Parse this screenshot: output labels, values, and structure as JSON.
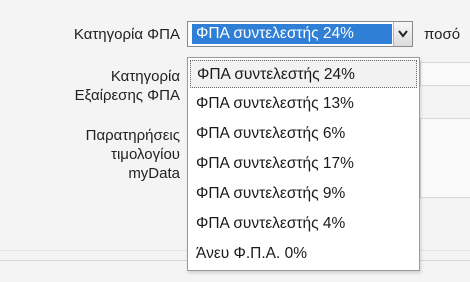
{
  "form": {
    "vat_category_label": "Κατηγορία ΦΠΑ",
    "exempt_label_line1": "Κατηγορία",
    "exempt_label_line2": "Εξαίρεσης ΦΠΑ",
    "notes_label_line1": "Παρατηρήσεις",
    "notes_label_line2": "τιμολογίου",
    "notes_label_line3": "myData",
    "next_field_label_partial": "ποσό"
  },
  "vat_select": {
    "selected": "ΦΠΑ συντελεστής 24%",
    "arrow_icon": "chevron-down-icon",
    "options": [
      "ΦΠΑ συντελεστής 24%",
      "ΦΠΑ συντελεστής 13%",
      "ΦΠΑ συντελεστής 6%",
      "ΦΠΑ συντελεστής 17%",
      "ΦΠΑ συντελεστής 9%",
      "ΦΠΑ συντελεστής 4%",
      "Άνευ Φ.Π.Α. 0%"
    ]
  },
  "colors": {
    "selection_blue": "#2f7fd6"
  }
}
